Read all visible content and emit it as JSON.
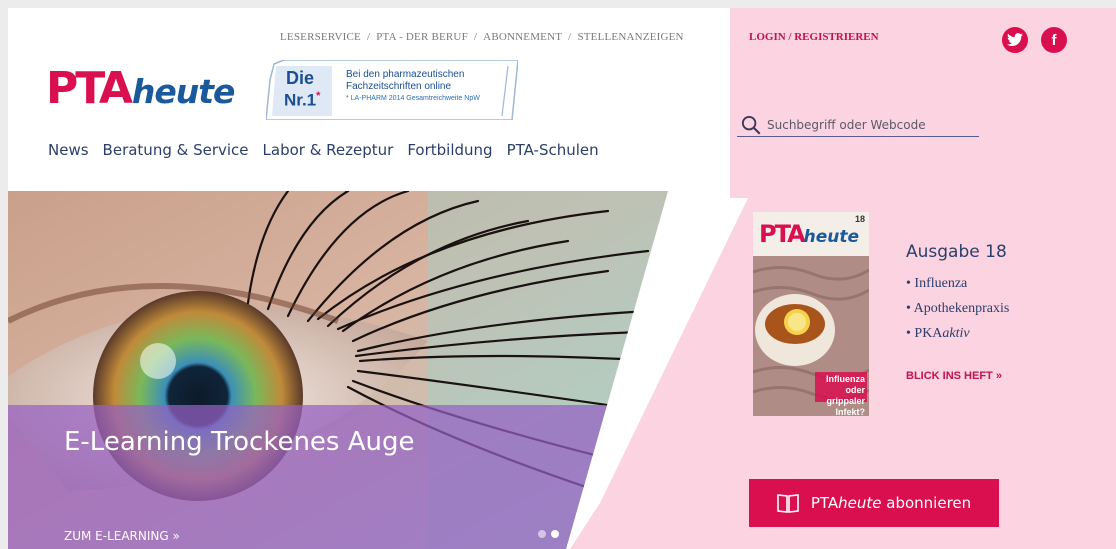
{
  "top_nav": {
    "items": [
      "LESERSERVICE",
      "PTA - DER BERUF",
      "ABONNEMENT",
      "STELLENANZEIGEN"
    ],
    "separator": "/",
    "login": "LOGIN / REGISTRIEREN"
  },
  "social": {
    "twitter_glyph": "t",
    "facebook_glyph": "f",
    "color": "#d90f4f"
  },
  "logo": {
    "pta": "PTA",
    "heute": "heute"
  },
  "badge": {
    "die": "Die",
    "nr": "Nr.1",
    "star": "*",
    "line1": "Bei den pharmazeutischen",
    "line2": "Fachzeitschriften online",
    "line3": "* LA-PHARM 2014 Gesamtreichweite NpW"
  },
  "main_nav": {
    "items": [
      "News",
      "Beratung & Service",
      "Labor & Rezeptur",
      "Fortbildung",
      "PTA-Schulen"
    ]
  },
  "search": {
    "placeholder": "Suchbegriff oder Webcode"
  },
  "hero": {
    "title": "E-Learning Trockenes Auge",
    "cta": "ZUM E-LEARNING »",
    "slide_count": 2,
    "active_slide": 2
  },
  "magazine": {
    "cover_logo_pta": "PTA",
    "cover_logo_heute": "heute",
    "cover_issue": "18",
    "cover_headline1": "Influenza oder",
    "cover_headline2": "grippaler Infekt?",
    "title": "Ausgabe 18",
    "topic1": "Influenza",
    "topic2": "Apothekenpraxis",
    "topic3_plain": "PKA",
    "topic3_italic": "aktiv",
    "link": "BLICK INS HEFT »"
  },
  "subscribe": {
    "pre": "PTA",
    "italic": "heute",
    "post": " abonnieren"
  },
  "colors": {
    "brand_pink": "#d90f4f",
    "panel_pink": "#fcd3e0",
    "navy": "#2a3f6b",
    "hero_overlay": "#9660c4"
  }
}
